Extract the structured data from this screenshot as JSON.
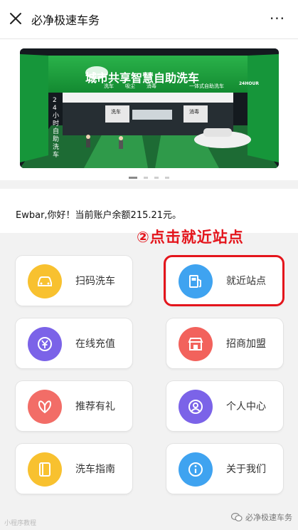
{
  "header": {
    "title": "必净极速车务",
    "more_label": "···"
  },
  "banner": {
    "headline": "城市共享智慧自助洗车",
    "sub_items": [
      "洗车",
      "吸尘",
      "消毒",
      "一体式自助洗车"
    ],
    "badge": "24HOUR",
    "side_text": "24小时自助洗车",
    "booth_labels": [
      "洗车",
      "消毒"
    ],
    "slide_count": 4,
    "active_slide": 0
  },
  "account": {
    "balance_text": "Ewbar,你好！当前账户余额215.21元。"
  },
  "annotation": {
    "text": "②点击就近站点"
  },
  "menu": [
    {
      "key": "scan",
      "label": "扫码洗车",
      "icon": "car-icon",
      "color": "#f8c12f"
    },
    {
      "key": "nearby",
      "label": "就近站点",
      "icon": "gas-station-icon",
      "color": "#3fa3f0"
    },
    {
      "key": "recharge",
      "label": "在线充值",
      "icon": "yuan-coin-icon",
      "color": "#7b63e8"
    },
    {
      "key": "franchise",
      "label": "招商加盟",
      "icon": "storefront-icon",
      "color": "#f2625c"
    },
    {
      "key": "referral",
      "label": "推荐有礼",
      "icon": "gift-icon",
      "color": "#f26d67"
    },
    {
      "key": "profile",
      "label": "个人中心",
      "icon": "user-icon",
      "color": "#7b63e8"
    },
    {
      "key": "guide",
      "label": "洗车指南",
      "icon": "guide-book-icon",
      "color": "#f8c12f"
    },
    {
      "key": "about",
      "label": "关于我们",
      "icon": "info-icon",
      "color": "#3fa3f0"
    }
  ],
  "watermark": {
    "left": "小程序教程",
    "right": "必净极速车务"
  }
}
